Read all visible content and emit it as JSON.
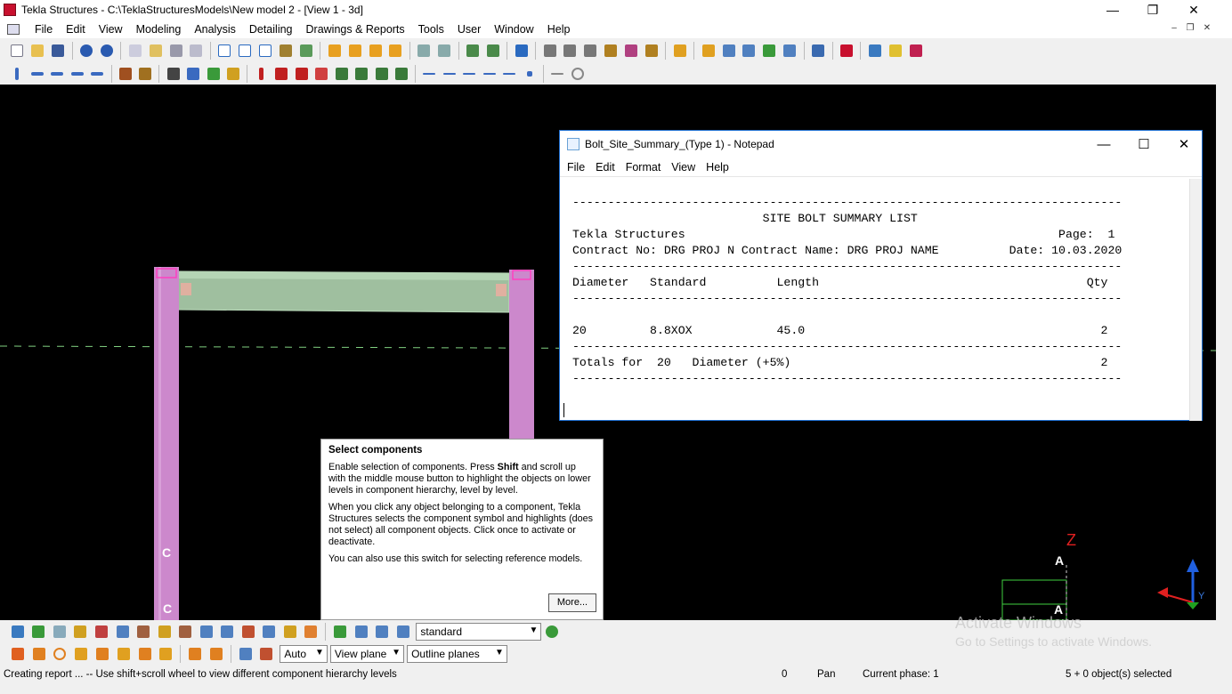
{
  "window": {
    "title": "Tekla Structures - C:\\TeklaStructuresModels\\New model 2  - [View 1 - 3d]",
    "controls": {
      "minimize": "—",
      "restore": "❐",
      "close": "✕"
    }
  },
  "menu": [
    "File",
    "Edit",
    "View",
    "Modeling",
    "Analysis",
    "Detailing",
    "Drawings & Reports",
    "Tools",
    "User",
    "Window",
    "Help"
  ],
  "mdi_controls": {
    "minimize": "–",
    "restore": "❐",
    "close": "✕"
  },
  "viewport": {
    "labels": {
      "column_left": "C",
      "column_left_bottom": "C",
      "gridA_top": "A",
      "gridA_bottom": "A",
      "axis_z": "Z",
      "axis_y": "Y"
    }
  },
  "notepad": {
    "title": "Bolt_Site_Summary_(Type 1) - Notepad",
    "menu": [
      "File",
      "Edit",
      "Format",
      "View",
      "Help"
    ],
    "lines": [
      "------------------------------------------------------------------------------",
      "                           SITE BOLT SUMMARY LIST",
      "Tekla Structures                                                     Page:  1",
      "Contract No: DRG PROJ N Contract Name: DRG PROJ NAME          Date: 10.03.2020",
      "------------------------------------------------------------------------------",
      "Diameter   Standard          Length                                      Qty",
      "------------------------------------------------------------------------------",
      "",
      "20         8.8XOX            45.0                                          2",
      "------------------------------------------------------------------------------",
      "Totals for  20   Diameter (+5%)                                            2",
      "------------------------------------------------------------------------------"
    ]
  },
  "tooltip": {
    "title": "Select components",
    "p1_a": "Enable selection of components. Press ",
    "p1_b": "Shift",
    "p1_c": " and scroll up with the middle mouse button to highlight the objects on lower levels in component hierarchy, level by level.",
    "p2": "When you click any object belonging to a component, Tekla Structures selects the component symbol and highlights (does not select) all component objects. Click once to activate or deactivate.",
    "p3": "You can also use this switch for selecting reference models.",
    "more": "More..."
  },
  "selection_filter": {
    "value": "standard"
  },
  "snap_bar": {
    "depth": "Auto",
    "plane": "View plane",
    "outline": "Outline planes"
  },
  "status": {
    "message": "Creating report ... -- Use shift+scroll wheel to view different component hierarchy levels",
    "count": "0",
    "mode": "Pan",
    "phase": "Current phase: 1",
    "selected": "5 + 0 object(s) selected"
  },
  "watermark": {
    "line1": "Activate Windows",
    "line2": "Go to Settings to activate Windows."
  },
  "colors": {
    "beam": "#9fbf9f",
    "column": "#cc88cc",
    "grid": "#80d080",
    "axis_blue": "#2060e0",
    "axis_red": "#e02020",
    "axis_green": "#20a020"
  }
}
